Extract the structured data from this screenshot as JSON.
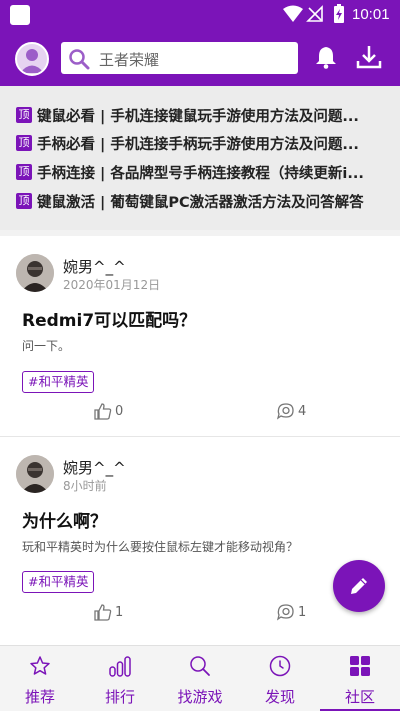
{
  "status_bar": {
    "time": "10:01"
  },
  "search": {
    "placeholder": "王者荣耀"
  },
  "pinned": [
    {
      "badge": "顶",
      "text": "键鼠必看 | 手机连接键鼠玩手游使用方法及问题..."
    },
    {
      "badge": "顶",
      "text": "手柄必看 | 手机连接手柄玩手游使用方法及问题..."
    },
    {
      "badge": "顶",
      "text": "手柄连接 | 各品牌型号手柄连接教程（持续更新i..."
    },
    {
      "badge": "顶",
      "text": "键鼠激活 | 葡萄键鼠PC激活器激活方法及问答解答"
    }
  ],
  "posts": [
    {
      "author": "婉男^_^",
      "time": "2020年01月12日",
      "title": "Redmi7可以匹配吗？",
      "body": "问一下。",
      "tag": "#和平精英",
      "likes": "0",
      "comments": "4"
    },
    {
      "author": "婉男^_^",
      "time": "8小时前",
      "title": "为什么啊？",
      "body": "玩和平精英时为什么要按住鼠标左键才能移动视角？",
      "tag": "#和平精英",
      "likes": "1",
      "comments": "1"
    }
  ],
  "nav": [
    {
      "label": "推荐",
      "icon": "star-icon"
    },
    {
      "label": "排行",
      "icon": "ranking-icon"
    },
    {
      "label": "找游戏",
      "icon": "search-game-icon"
    },
    {
      "label": "发现",
      "icon": "compass-icon"
    },
    {
      "label": "社区",
      "icon": "grid-icon",
      "active": true
    }
  ],
  "colors": {
    "brand": "#7b14b8"
  }
}
